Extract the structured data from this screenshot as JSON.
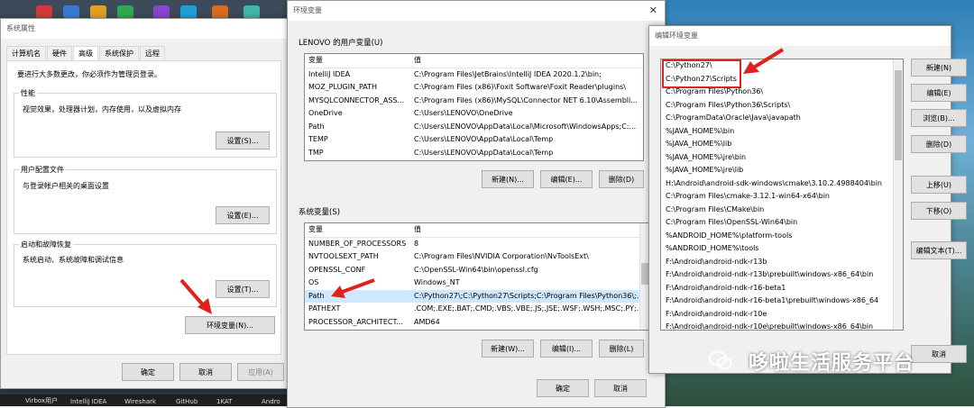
{
  "sysprops": {
    "title": "系统属性",
    "tabs": [
      "计算机名",
      "硬件",
      "高级",
      "系统保护",
      "远程"
    ],
    "admin_note": "要进行大多数更改，你必须作为管理员登录。",
    "performance": {
      "title": "性能",
      "desc": "视觉效果，处理器计划，内存使用，以及虚拟内存",
      "button": "设置(S)..."
    },
    "profile": {
      "title": "用户配置文件",
      "desc": "与登录帐户相关的桌面设置",
      "button": "设置(E)..."
    },
    "startup": {
      "title": "启动和故障恢复",
      "desc": "系统启动、系统故障和调试信息",
      "button": "设置(T)..."
    },
    "env_button": "环境变量(N)...",
    "ok": "确定",
    "cancel": "取消",
    "apply": "应用(A)"
  },
  "envvars": {
    "title": "环境变量",
    "user_title": "LENOVO 的用户变量(U)",
    "col_var": "变量",
    "col_val": "值",
    "user_rows": [
      {
        "name": "IntelliJ IDEA",
        "value": "C:\\Program Files\\JetBrains\\IntelliJ IDEA 2020.1.2\\bin;"
      },
      {
        "name": "MOZ_PLUGIN_PATH",
        "value": "C:\\Program Files (x86)\\Foxit Software\\Foxit Reader\\plugins\\"
      },
      {
        "name": "MYSQLCONNECTOR_ASS...",
        "value": "C:\\Program Files (x86)\\MySQL\\Connector NET 6.10\\Assembli..."
      },
      {
        "name": "OneDrive",
        "value": "C:\\Users\\LENOVO\\OneDrive"
      },
      {
        "name": "Path",
        "value": "C:\\Users\\LENOVO\\AppData\\Local\\Microsoft\\WindowsApps;C:..."
      },
      {
        "name": "TEMP",
        "value": "C:\\Users\\LENOVO\\AppData\\Local\\Temp"
      },
      {
        "name": "TMP",
        "value": "C:\\Users\\LENOVO\\AppData\\Local\\Temp"
      }
    ],
    "user_new": "新建(N)...",
    "user_edit": "编辑(E)...",
    "user_delete": "删除(D)",
    "sys_title": "系统变量(S)",
    "sys_rows": [
      {
        "name": "NUMBER_OF_PROCESSORS",
        "value": "8"
      },
      {
        "name": "NVTOOLSEXT_PATH",
        "value": "C:\\Program Files\\NVIDIA Corporation\\NvToolsExt\\"
      },
      {
        "name": "OPENSSL_CONF",
        "value": "C:\\OpenSSL-Win64\\bin\\openssl.cfg"
      },
      {
        "name": "OS",
        "value": "Windows_NT"
      },
      {
        "name": "Path",
        "value": "C:\\Python27\\;C:\\Python27\\Scripts;C:\\Program Files\\Python36\\;..."
      },
      {
        "name": "PATHEXT",
        "value": ".COM;.EXE;.BAT;.CMD;.VBS;.VBE;.JS;.JSE;.WSF;.WSH;.MSC;.PY;.P..."
      },
      {
        "name": "PROCESSOR_ARCHITECT...",
        "value": "AMD64"
      }
    ],
    "sys_new": "新建(W)...",
    "sys_edit": "编辑(I)...",
    "sys_delete": "删除(L)",
    "ok": "确定",
    "cancel": "取消"
  },
  "editenv": {
    "title": "编辑环境变量",
    "items": [
      "C:\\Python27\\",
      "C:\\Python27\\Scripts",
      "C:\\Program Files\\Python36\\",
      "C:\\Program Files\\Python36\\Scripts\\",
      "C:\\ProgramData\\Oracle\\Java\\javapath",
      "%JAVA_HOME%\\bin",
      "%JAVA_HOME%\\lib",
      "%JAVA_HOME%\\jre\\bin",
      "%JAVA_HOME%\\jre\\lib",
      "H:\\Android\\android-sdk-windows\\cmake\\3.10.2.4988404\\bin",
      "C:\\Program Files\\cmake-3.12.1-win64-x64\\bin",
      "C:\\Program Files\\CMake\\bin",
      "C:\\Program Files\\OpenSSL-Win64\\bin",
      "%ANDROID_HOME%\\platform-tools",
      "%ANDROID_HOME%\\tools",
      "F:\\Android\\android-ndk-r13b",
      "F:\\Android\\android-ndk-r13b\\prebuilt\\windows-x86_64\\bin",
      "F:\\Android\\android-ndk-r16-beta1",
      "F:\\Android\\android-ndk-r16-beta1\\prebuilt\\windows-x86_64",
      "F:\\Android\\android-ndk-r10e",
      "F:\\Android\\android-ndk-r10e\\prebuilt\\windows-x86_64\\bin"
    ],
    "btn_new": "新建(N)",
    "btn_edit": "编辑(E)",
    "btn_browse": "浏览(B)...",
    "btn_delete": "删除(D)",
    "btn_up": "上移(U)",
    "btn_down": "下移(O)",
    "btn_edit_text": "编辑文本(T)...",
    "cancel": "取消"
  },
  "watermark": "哆啦生活服务平台",
  "taskbar": [
    "Virbox用户",
    "IntelliJ IDEA",
    "Wireshark",
    "GitHub",
    "1KAT",
    "Andro"
  ],
  "colors": {
    "highlight_red": "#e0221c",
    "selection": "#cde8ff",
    "button": "#e1e1e1"
  }
}
